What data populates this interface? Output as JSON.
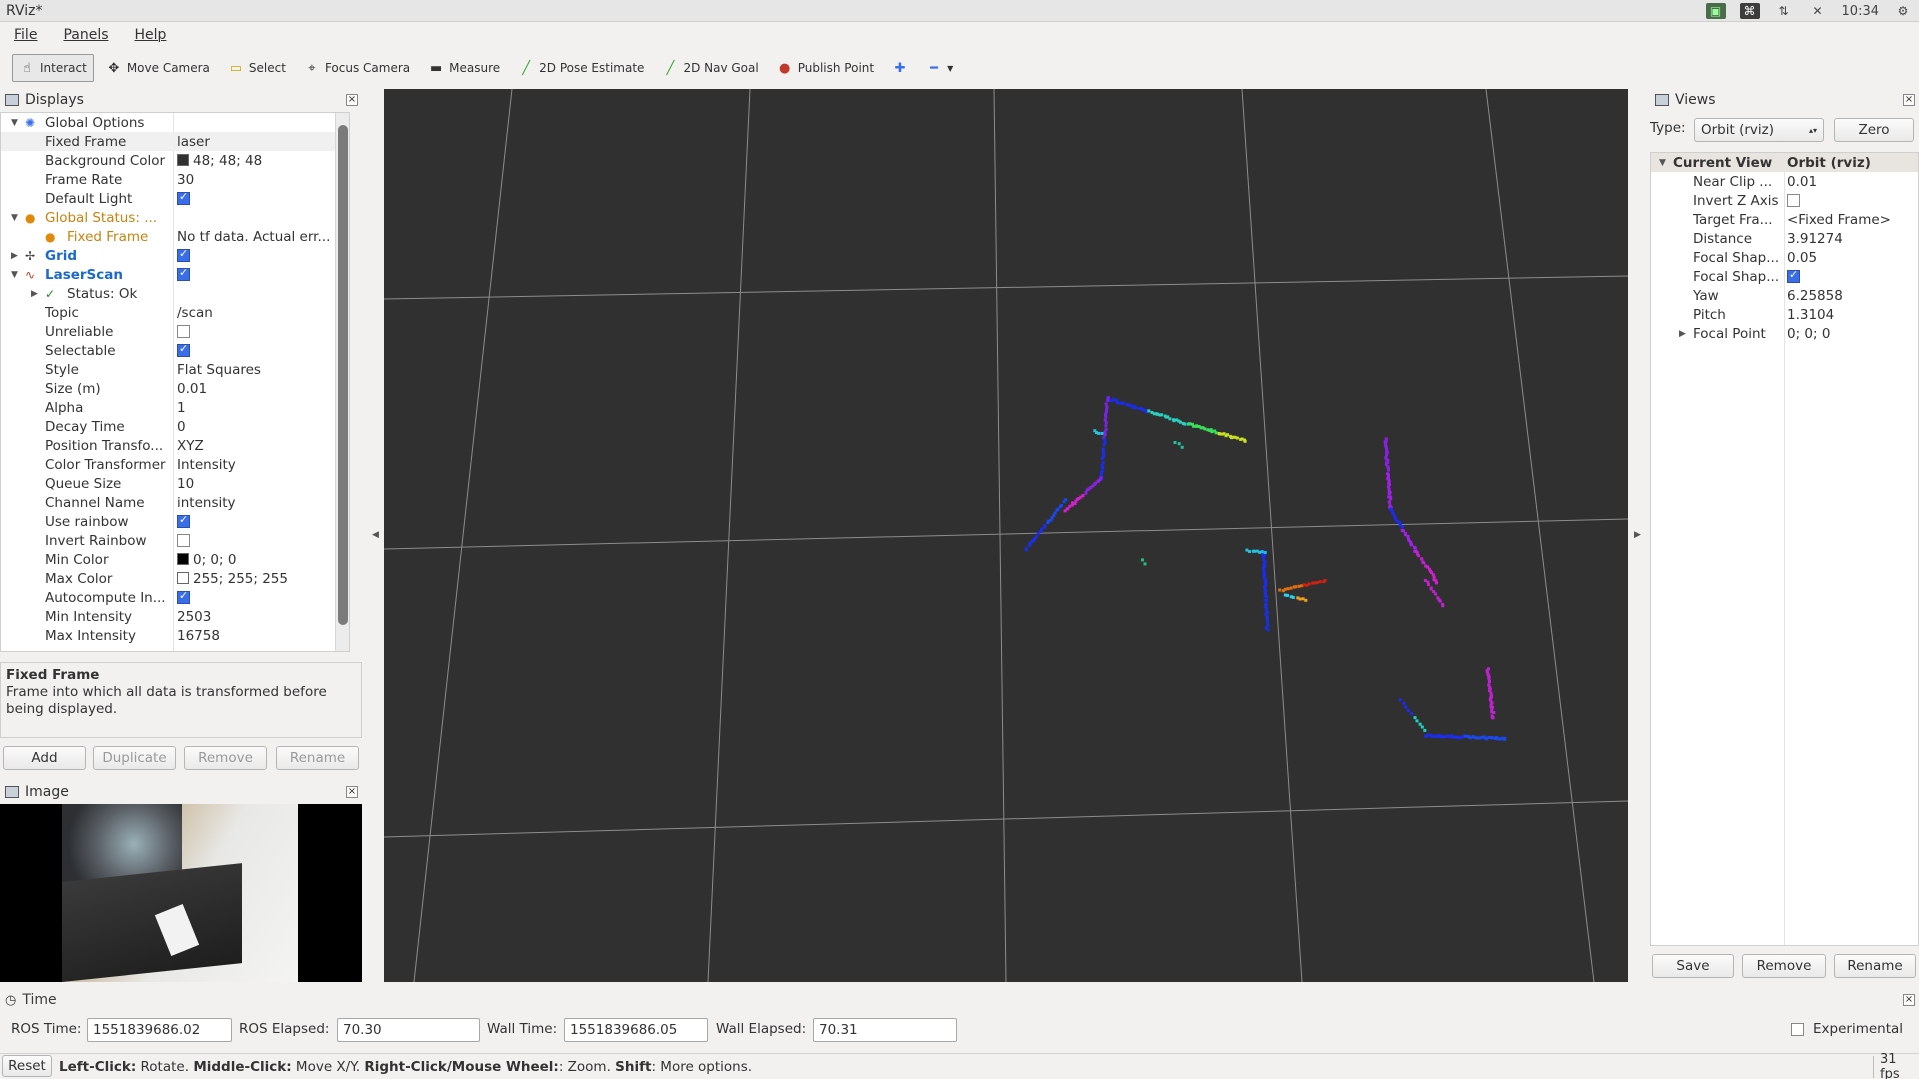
{
  "window": {
    "title": "RViz*",
    "clock": "10:34"
  },
  "menu": [
    "File",
    "Panels",
    "Help"
  ],
  "toolbar": [
    {
      "label": "Interact",
      "icon": "hand-icon",
      "active": true
    },
    {
      "label": "Move Camera",
      "icon": "move-camera-icon"
    },
    {
      "label": "Select",
      "icon": "select-icon"
    },
    {
      "label": "Focus Camera",
      "icon": "focus-camera-icon"
    },
    {
      "label": "Measure",
      "icon": "ruler-icon"
    },
    {
      "label": "2D Pose Estimate",
      "icon": "green-arrow-icon"
    },
    {
      "label": "2D Nav Goal",
      "icon": "green-arrow-icon"
    },
    {
      "label": "Publish Point",
      "icon": "map-pin-icon"
    }
  ],
  "displays": {
    "title": "Displays",
    "rows": [
      {
        "key": "Global Options"
      },
      {
        "key": "Fixed Frame",
        "value": "laser"
      },
      {
        "key": "Background Color",
        "value": "48; 48; 48"
      },
      {
        "key": "Frame Rate",
        "value": "30"
      },
      {
        "key": "Default Light"
      },
      {
        "key": "Global Status: ..."
      },
      {
        "key": "Fixed Frame",
        "value": "No tf data.  Actual err..."
      },
      {
        "key": "Grid"
      },
      {
        "key": "LaserScan"
      },
      {
        "key": "Status: Ok"
      },
      {
        "key": "Topic",
        "value": "/scan"
      },
      {
        "key": "Unreliable"
      },
      {
        "key": "Selectable"
      },
      {
        "key": "Style",
        "value": "Flat Squares"
      },
      {
        "key": "Size (m)",
        "value": "0.01"
      },
      {
        "key": "Alpha",
        "value": "1"
      },
      {
        "key": "Decay Time",
        "value": "0"
      },
      {
        "key": "Position Transfo...",
        "value": "XYZ"
      },
      {
        "key": "Color Transformer",
        "value": "Intensity"
      },
      {
        "key": "Queue Size",
        "value": "10"
      },
      {
        "key": "Channel Name",
        "value": "intensity"
      },
      {
        "key": "Use rainbow"
      },
      {
        "key": "Invert Rainbow"
      },
      {
        "key": "Min Color",
        "value": "0; 0; 0"
      },
      {
        "key": "Max Color",
        "value": "255; 255; 255"
      },
      {
        "key": "Autocompute In..."
      },
      {
        "key": "Min Intensity",
        "value": "2503"
      },
      {
        "key": "Max Intensity",
        "value": "16758"
      }
    ]
  },
  "description": {
    "title": "Fixed Frame",
    "text": "Frame into which all data is transformed before being displayed."
  },
  "display_buttons": {
    "add": "Add",
    "duplicate": "Duplicate",
    "remove": "Remove",
    "rename": "Rename"
  },
  "image_panel": {
    "title": "Image"
  },
  "views": {
    "title": "Views",
    "type_label": "Type:",
    "type_value": "Orbit (rviz)",
    "zero": "Zero",
    "rows": [
      {
        "key": "Current View",
        "value": "Orbit (rviz)"
      },
      {
        "key": "Near Clip ...",
        "value": "0.01"
      },
      {
        "key": "Invert Z Axis"
      },
      {
        "key": "Target Fra...",
        "value": "<Fixed Frame>"
      },
      {
        "key": "Distance",
        "value": "3.91274"
      },
      {
        "key": "Focal Shap...",
        "value": "0.05"
      },
      {
        "key": "Focal Shap..."
      },
      {
        "key": "Yaw",
        "value": "6.25858"
      },
      {
        "key": "Pitch",
        "value": "1.3104"
      },
      {
        "key": "Focal Point",
        "value": "0; 0; 0"
      }
    ],
    "save": "Save",
    "remove": "Remove",
    "rename": "Rename"
  },
  "time": {
    "title": "Time",
    "ros_time_label": "ROS Time:",
    "ros_time": "1551839686.02",
    "ros_elapsed_label": "ROS Elapsed:",
    "ros_elapsed": "70.30",
    "wall_time_label": "Wall Time:",
    "wall_time": "1551839686.05",
    "wall_elapsed_label": "Wall Elapsed:",
    "wall_elapsed": "70.31",
    "experimental": "Experimental"
  },
  "status": {
    "reset": "Reset",
    "left": "Left-Click:",
    "left_t": " Rotate. ",
    "middle": "Middle-Click:",
    "middle_t": " Move X/Y. ",
    "right": "Right-Click/Mouse Wheel:",
    "right_t": ": Zoom. ",
    "shift": "Shift",
    "shift_t": ": More options.",
    "fps": "31 fps"
  },
  "colors": {
    "background": "#303030",
    "grid": "#a0a0a0",
    "accent": "#3a6ee8"
  }
}
